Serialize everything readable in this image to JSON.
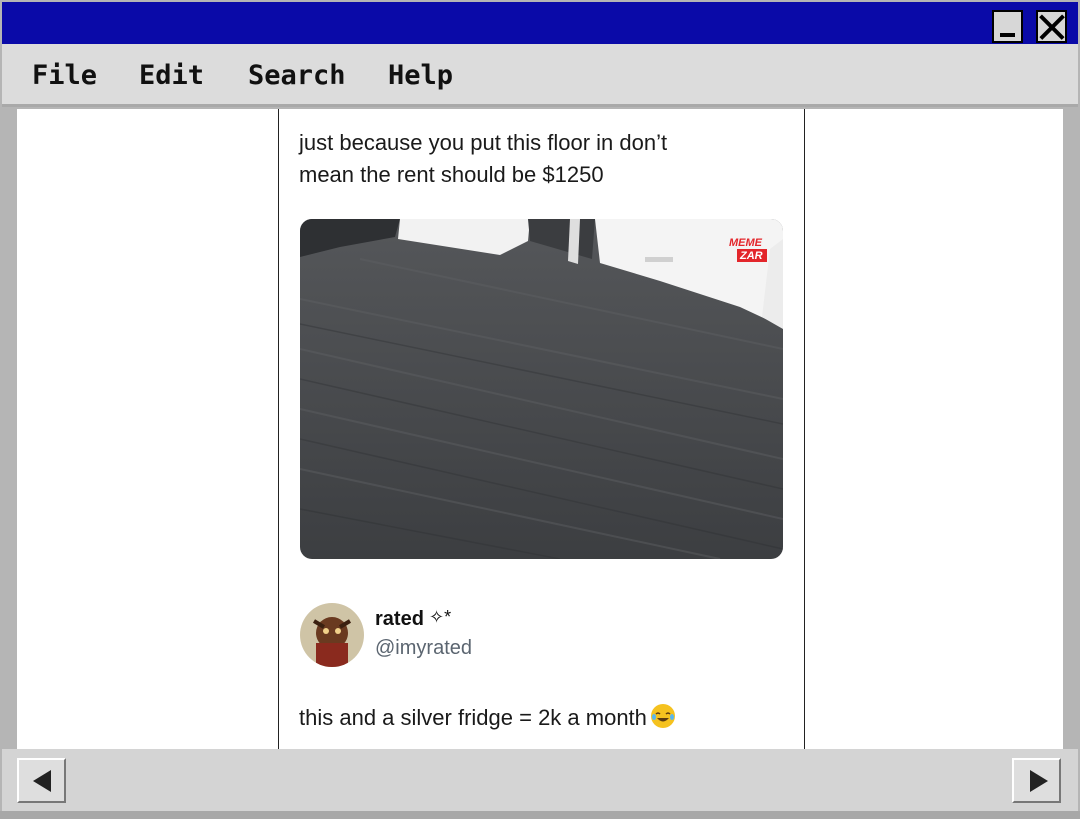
{
  "window": {
    "minimize_label": "_",
    "close_label": "X"
  },
  "menu": {
    "file": "File",
    "edit": "Edit",
    "search": "Search",
    "help": "Help"
  },
  "post": {
    "text_line1": "just because you put this floor in don’t",
    "text_line2": "mean the rent should be $1250",
    "image_watermark_top": "MEME",
    "image_watermark_bottom": "ZAR"
  },
  "reply": {
    "user_name": "rated",
    "user_name_suffix": "✧*",
    "user_handle": "@imyrated",
    "text": "this and a silver fridge = 2k a month",
    "emoji": "face-with-tears-of-joy"
  },
  "scrollbar": {
    "left_icon": "arrow-left-icon",
    "right_icon": "arrow-right-icon"
  }
}
